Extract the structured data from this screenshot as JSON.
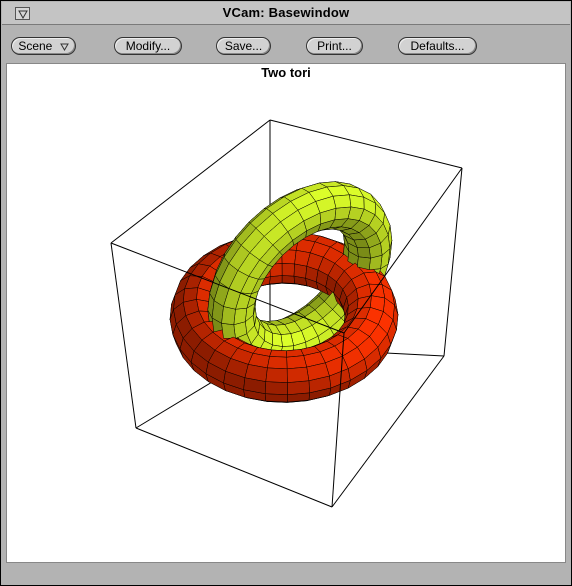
{
  "window": {
    "title": "VCam: Basewindow"
  },
  "toolbar": {
    "scene_label": "Scene",
    "modify_label": "Modify...",
    "save_label": "Save...",
    "print_label": "Print...",
    "defaults_label": "Defaults..."
  },
  "canvas": {
    "title": "Two tori",
    "colors": {
      "red_torus": "#ff3300",
      "yellow_torus": "#ddff2a",
      "mesh": "#000000",
      "frame": "#000000"
    }
  }
}
